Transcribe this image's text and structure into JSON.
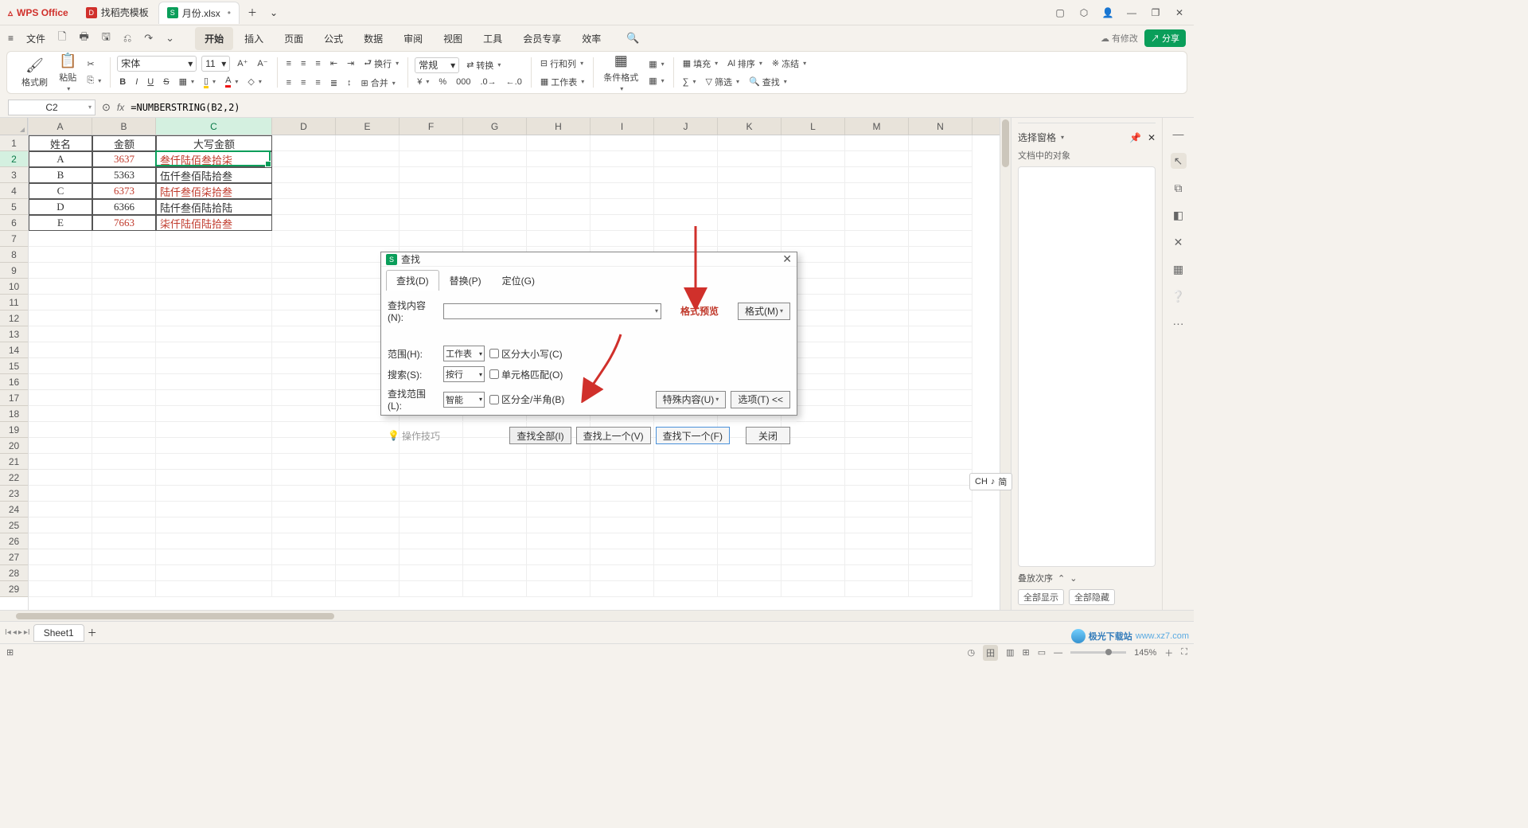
{
  "titlebar": {
    "app": "WPS Office",
    "template_tab": "找稻壳模板",
    "doc_icon": "S",
    "doc_name": "月份.xlsx",
    "dirty": "•",
    "add": "＋",
    "more": "⌄"
  },
  "window_controls": [
    "▢",
    "⬡",
    "👤",
    "—",
    "❐",
    "✕"
  ],
  "menubar": {
    "left": [
      "≡",
      "文件",
      "🗋",
      "🖶",
      "🖫",
      "⎌",
      "↷",
      "⌄"
    ],
    "tabs": [
      "开始",
      "插入",
      "页面",
      "公式",
      "数据",
      "审阅",
      "视图",
      "工具",
      "会员专享",
      "效率"
    ],
    "active": "开始",
    "search": "🔍",
    "cloud": "有修改",
    "share": "分享"
  },
  "ribbon": {
    "clip": {
      "fmtbrush": "格式刷",
      "paste": "粘贴",
      "cut": "✂"
    },
    "font": {
      "name": "宋体",
      "size": "11",
      "bigA": "A⁺",
      "smallA": "A⁻",
      "bold": "B",
      "italic": "I",
      "underline": "U",
      "strike": "S"
    },
    "align": {
      "hdr": "",
      "wrap": "换行",
      "merge": "合并"
    },
    "num": {
      "fmt": "常规",
      "conv": "转换",
      "currency": "¥",
      "pct": "%",
      "comma": ",",
      "dec_inc": ".0",
      "dec_dec": ".00"
    },
    "cell": {
      "rowcol": "行和列",
      "worksheet": "工作表"
    },
    "style": {
      "condfmt": "条件格式",
      "styles": "▦",
      "tablefmt": "▦"
    },
    "edit": {
      "sum": "∑",
      "fill": "填充",
      "sort": "排序",
      "freeze": "冻结",
      "filter": "筛选",
      "find": "查找"
    }
  },
  "fbar": {
    "cell": "C2",
    "fx": "fx",
    "formula": "=NUMBERSTRING(B2,2)"
  },
  "cols": [
    "A",
    "B",
    "C",
    "D",
    "E",
    "F",
    "G",
    "H",
    "I",
    "J",
    "K",
    "L",
    "M",
    "N"
  ],
  "rows": 29,
  "active_cell": "C2",
  "table": {
    "head": [
      "姓名",
      "金额",
      "大写金额"
    ],
    "rows": [
      {
        "n": "A",
        "v": "3637",
        "t": "叁仟陆佰叁拾柒",
        "red": true
      },
      {
        "n": "B",
        "v": "5363",
        "t": "伍仟叁佰陆拾叁",
        "red": false
      },
      {
        "n": "C",
        "v": "6373",
        "t": "陆仟叁佰柒拾叁",
        "red": true
      },
      {
        "n": "D",
        "v": "6366",
        "t": "陆仟叁佰陆拾陆",
        "red": false
      },
      {
        "n": "E",
        "v": "7663",
        "t": "柒仟陆佰陆拾叁",
        "red": true
      }
    ]
  },
  "rpanel": {
    "title": "选择窗格",
    "sublabel": "文档中的对象",
    "stack": "叠放次序",
    "show_all": "全部显示",
    "hide_all": "全部隐藏"
  },
  "side_icons": [
    "▭",
    "⧉",
    "◧",
    "✕",
    "▦",
    "❔",
    "···"
  ],
  "sheet": {
    "name": "Sheet1"
  },
  "status": {
    "ready": "",
    "zoom": "145%",
    "modes": [
      "田",
      "▥",
      "⊞",
      "▭"
    ]
  },
  "dialog": {
    "title": "查找",
    "tabs": [
      "查找(D)",
      "替换(P)",
      "定位(G)"
    ],
    "active_tab": "查找(D)",
    "find_label": "查找内容(N):",
    "preview": "格式预览",
    "format_btn": "格式(M)",
    "scope_label": "范围(H):",
    "scope_val": "工作表",
    "case_ck": "区分大小写(C)",
    "search_label": "搜索(S):",
    "search_val": "按行",
    "cellmatch_ck": "单元格匹配(O)",
    "range_label": "查找范围(L):",
    "range_val": "智能",
    "halfwidth_ck": "区分全/半角(B)",
    "special": "特殊内容(U)",
    "options": "选项(T)  <<",
    "help": "操作技巧",
    "btn_all": "查找全部(I)",
    "btn_prev": "查找上一个(V)",
    "btn_next": "查找下一个(F)",
    "btn_close": "关闭"
  },
  "ime": {
    "lang": "CH",
    "note": "♪",
    "mode": "简"
  },
  "watermark": {
    "name": "极光下载站",
    "url": "www.xz7.com"
  }
}
